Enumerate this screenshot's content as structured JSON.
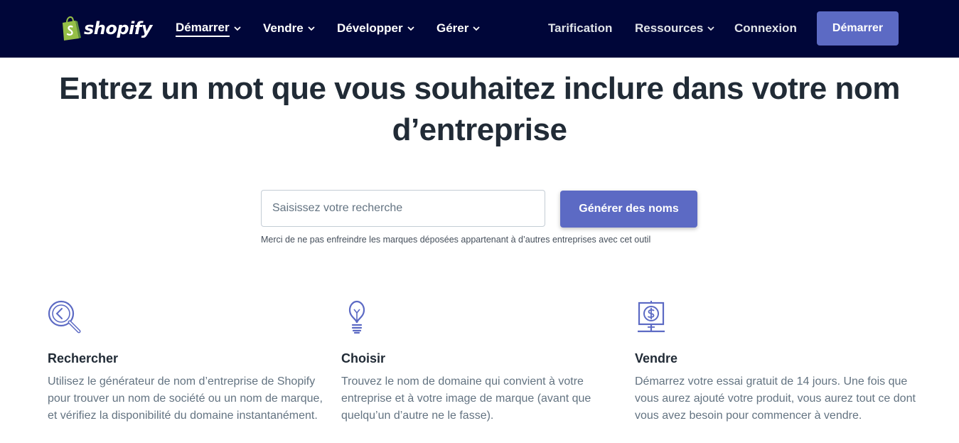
{
  "header": {
    "logo_text": "shopify",
    "nav": [
      {
        "label": "Démarrer",
        "active": true
      },
      {
        "label": "Vendre"
      },
      {
        "label": "Développer"
      },
      {
        "label": "Gérer"
      }
    ],
    "right": {
      "pricing": "Tarification",
      "resources": "Ressources",
      "login": "Connexion",
      "cta": "Démarrer"
    }
  },
  "main": {
    "headline": "Entrez un mot que vous souhaitez inclure dans votre nom d’entreprise",
    "search": {
      "placeholder": "Saisissez votre recherche",
      "value": ""
    },
    "generate_button": "Générer des noms",
    "disclaimer": "Merci de ne pas enfreindre les marques déposées appartenant à d’autres entreprises avec cet outil"
  },
  "features": [
    {
      "icon": "magnifier-icon",
      "title": "Rechercher",
      "text": "Utilisez le générateur de nom d’entreprise de Shopify pour trouver un nom de société ou un nom de marque, et vérifiez la disponibilité du domaine instantanément."
    },
    {
      "icon": "lightbulb-icon",
      "title": "Choisir",
      "text": "Trouvez le nom de domaine qui convient à votre entreprise et à votre image de marque (avant que quelqu’un d’autre ne le fasse)."
    },
    {
      "icon": "dollar-sign-icon",
      "title": "Vendre",
      "text": "Démarrez votre essai gratuit de 14 jours. Une fois que vous aurez ajouté votre produit, vous aurez tout ce dont vous avez besoin pour commencer à vendre."
    }
  ],
  "colors": {
    "header_bg": "#000639",
    "accent": "#5c6ac4",
    "logo_green": "#95bf47",
    "heading": "#212b36",
    "body_text": "#637381"
  }
}
